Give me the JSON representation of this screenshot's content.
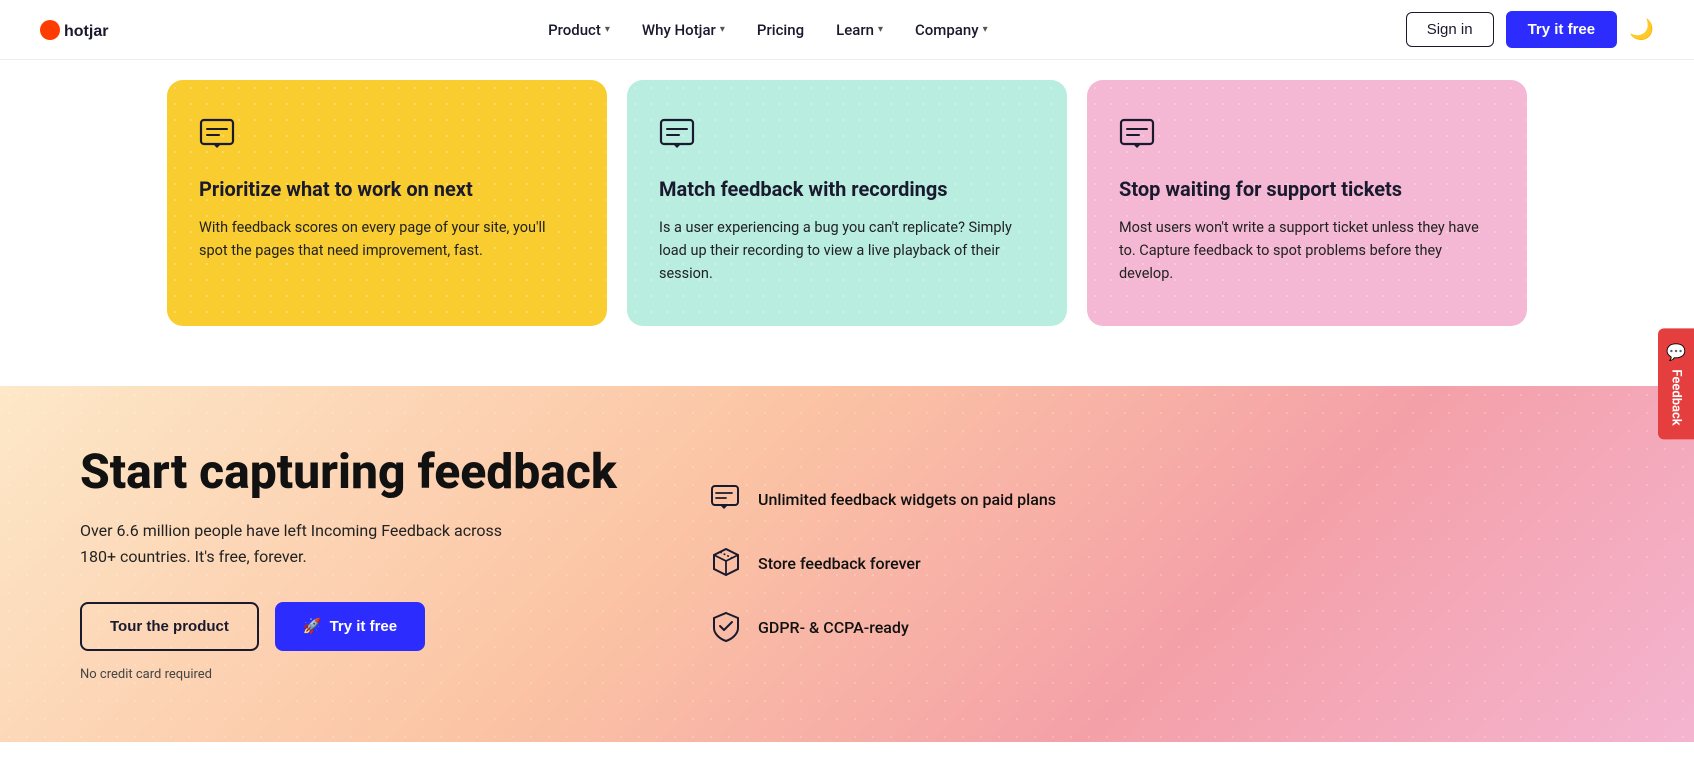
{
  "nav": {
    "logo_text": "hotjar",
    "links": [
      {
        "label": "Product",
        "has_dropdown": true
      },
      {
        "label": "Why Hotjar",
        "has_dropdown": true
      },
      {
        "label": "Pricing",
        "has_dropdown": false
      },
      {
        "label": "Learn",
        "has_dropdown": true
      },
      {
        "label": "Company",
        "has_dropdown": true
      }
    ],
    "signin_label": "Sign in",
    "try_free_label": "Try it free",
    "dark_mode_icon": "🌙"
  },
  "cards": [
    {
      "id": "card-1",
      "bg_class": "card-yellow",
      "title": "Prioritize what to work on next",
      "desc": "With feedback scores on every page of your site, you'll spot the pages that need improvement, fast."
    },
    {
      "id": "card-2",
      "bg_class": "card-mint",
      "title": "Match feedback with recordings",
      "desc": "Is a user experiencing a bug you can't replicate? Simply load up their recording to view a live playback of their session."
    },
    {
      "id": "card-3",
      "bg_class": "card-pink",
      "title": "Stop waiting for support tickets",
      "desc": "Most users won't write a support ticket unless they have to. Capture feedback to spot problems before they develop."
    }
  ],
  "cta": {
    "title": "Start capturing feedback",
    "desc": "Over 6.6 million people have left Incoming Feedback across 180+ countries. It's free, forever.",
    "tour_label": "Tour the product",
    "try_label": "Try it free",
    "no_cc_label": "No credit card required",
    "features": [
      {
        "label": "Unlimited feedback widgets on paid plans"
      },
      {
        "label": "Store feedback forever"
      },
      {
        "label": "GDPR- & CCPA-ready"
      }
    ]
  },
  "feedback_tab": {
    "label": "Feedback"
  }
}
